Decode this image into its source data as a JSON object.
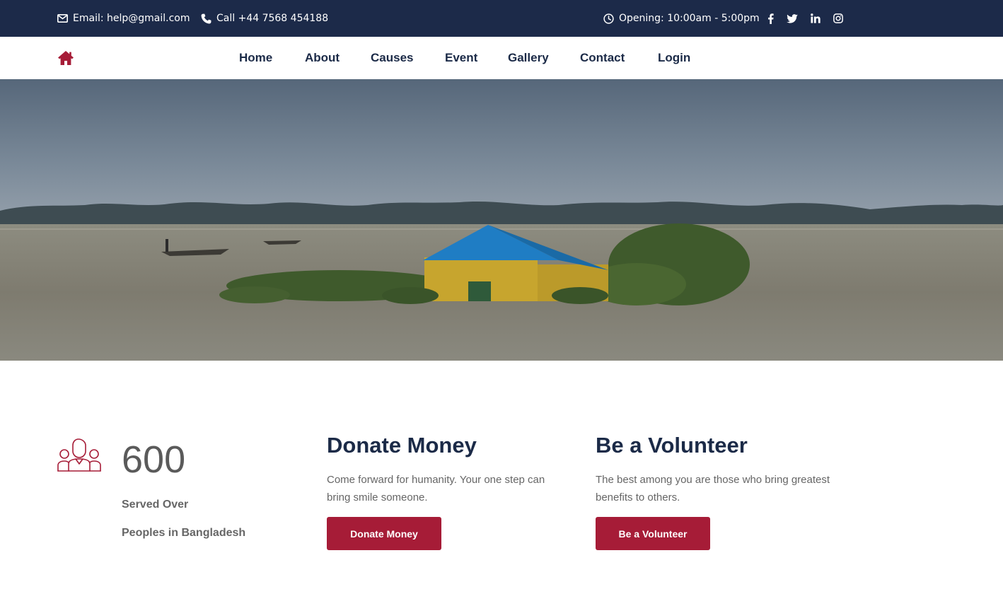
{
  "topbar": {
    "email": "Email: help@gmail.com",
    "phone": "Call +44 7568 454188",
    "opening": "Opening: 10:00am - 5:00pm",
    "social": [
      "facebook-icon",
      "twitter-icon",
      "linkedin-icon",
      "instagram-icon"
    ],
    "background": "#1c2a49"
  },
  "nav": {
    "logo_icon": "home-icon",
    "items": [
      "Home",
      "About",
      "Causes",
      "Event",
      "Gallery",
      "Contact",
      "Login"
    ]
  },
  "stats": {
    "icon": "people-group-icon",
    "number": "600",
    "line1": "Served Over",
    "line2": "Peoples in Bangladesh"
  },
  "cards": [
    {
      "title": "Donate Money",
      "text": "Come forward for humanity. Your one step can bring smile someone.",
      "button": "Donate Money"
    },
    {
      "title": "Be a Volunteer",
      "text": "The best among you are those who bring greatest benefits to others.",
      "button": "Be a Volunteer"
    }
  ],
  "colors": {
    "accent": "#a61c37",
    "navy": "#1b2a47"
  }
}
